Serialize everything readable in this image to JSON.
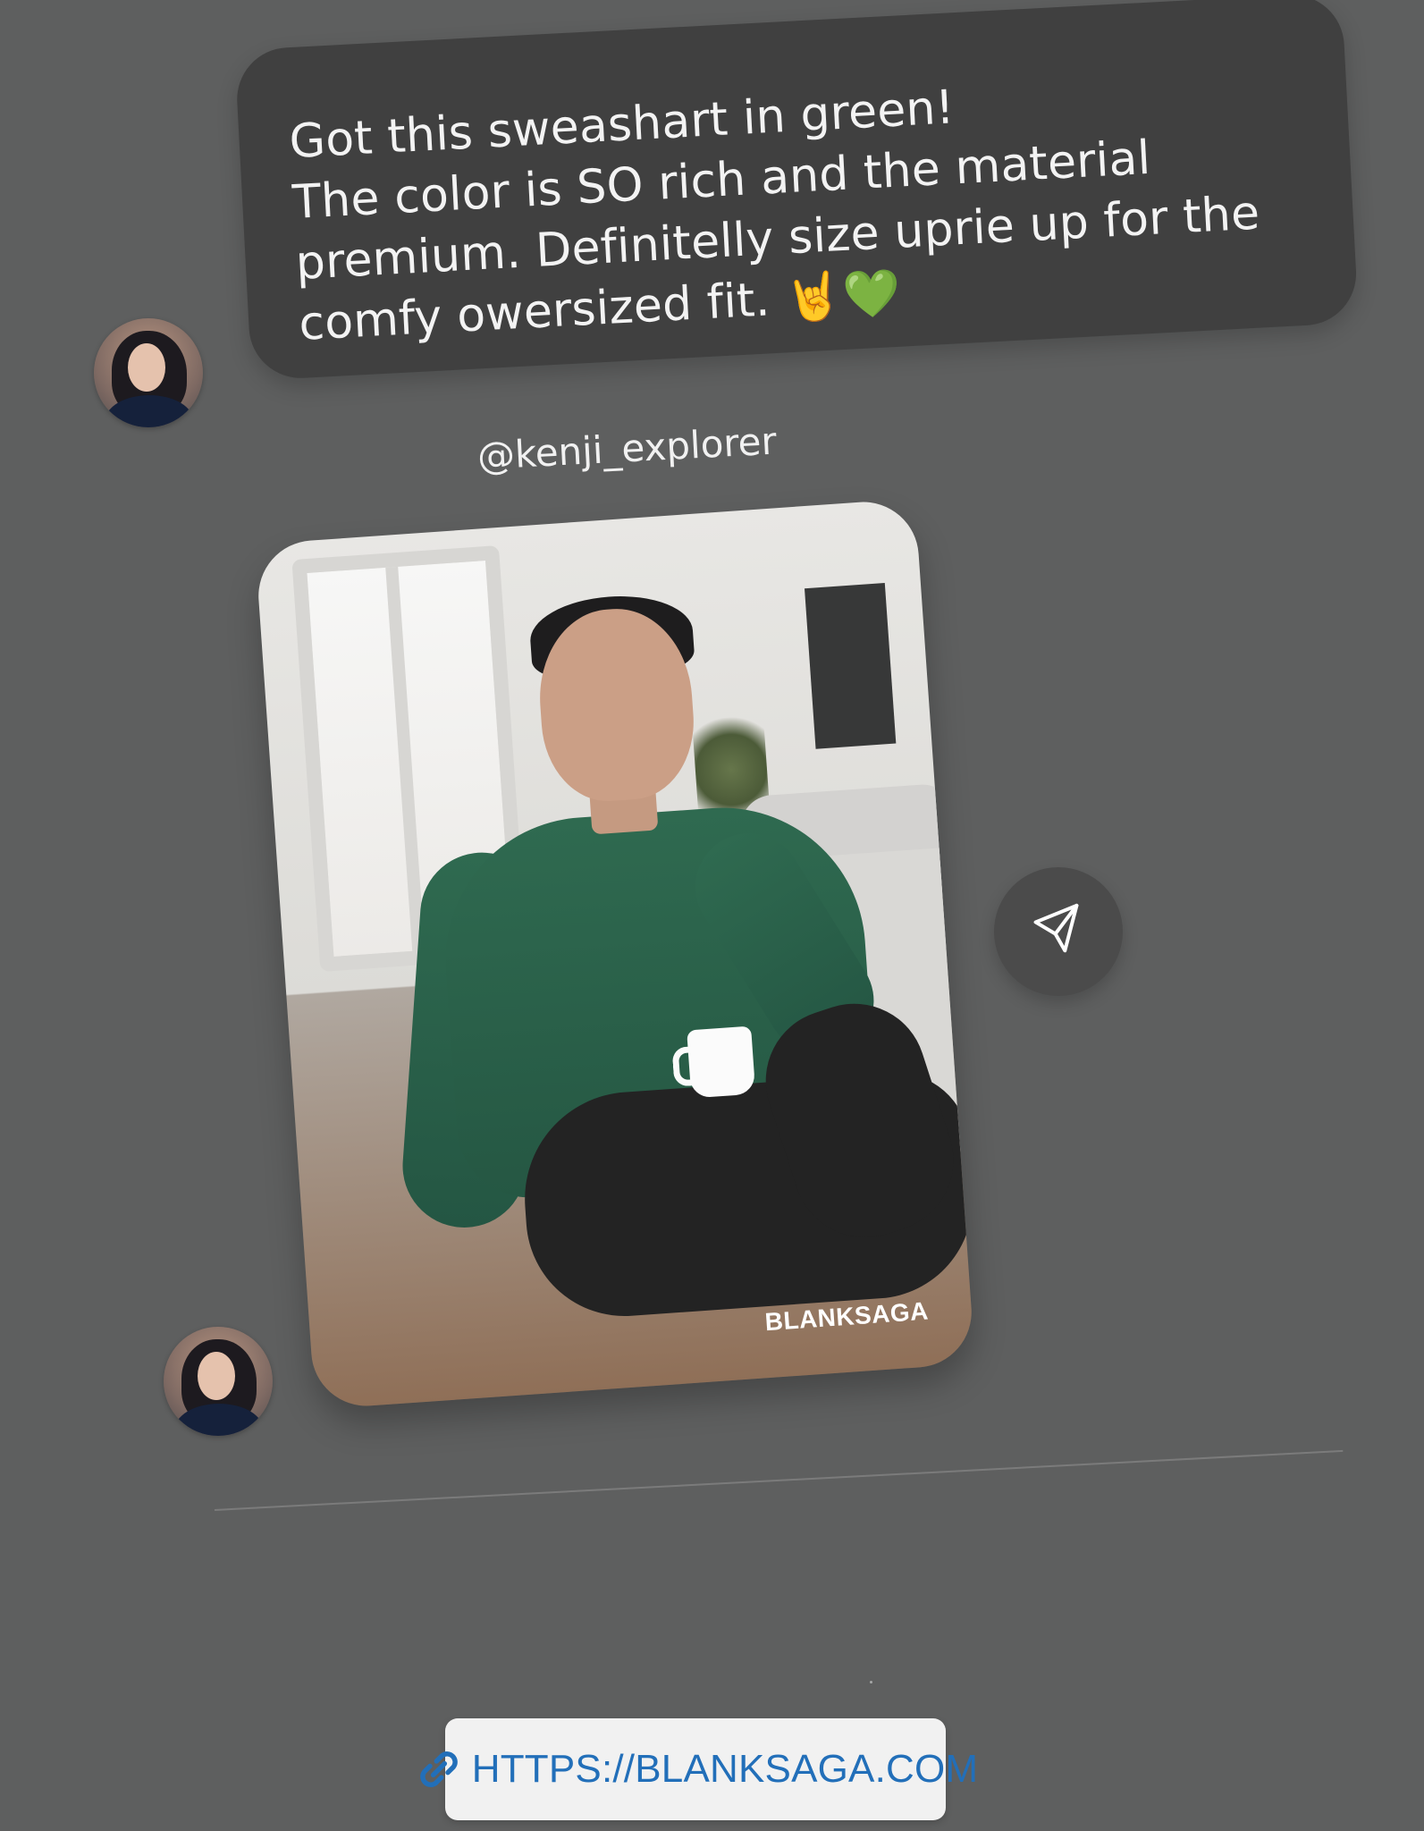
{
  "message": {
    "text": "Got this sweashart in green!\nThe color is SO rich and the material\npremium. Definitelly size uprie up for the\ncomfy owersized fit. 🤘💚"
  },
  "post": {
    "username": "@kenji_explorer",
    "brand_tag": "BLANKSAGA"
  },
  "link": {
    "label": "HTTPS://BLANKSAGA.COM"
  },
  "icons": {
    "share": "send-icon",
    "link": "link-icon"
  },
  "colors": {
    "background": "#5e5f5f",
    "bubble": "#404040",
    "link_text": "#226fb9"
  }
}
